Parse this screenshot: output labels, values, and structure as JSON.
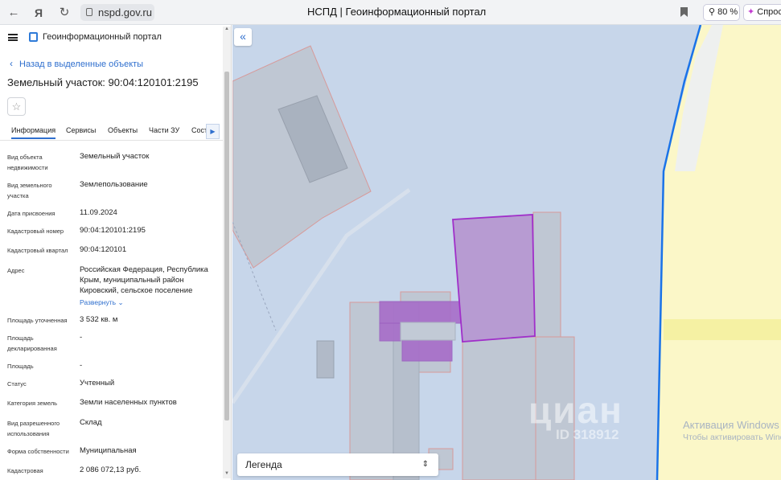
{
  "browser": {
    "url": "nspd.gov.ru",
    "tab_title": "НСПД | Геоинформационный портал",
    "zoom": "80 %",
    "ask_label": "Спроси"
  },
  "panel": {
    "brand": "Геоинформационный портал",
    "back_label": "Назад в выделенные объекты",
    "title": "Земельный участок: 90:04:120101:2195",
    "tabs": [
      "Информация",
      "Сервисы",
      "Объекты",
      "Части ЗУ",
      "Сост"
    ],
    "rows": [
      {
        "label": "Вид объекта недвижимости",
        "value": "Земельный участок"
      },
      {
        "label": "Вид земельного участка",
        "value": "Землепользование"
      },
      {
        "label": "Дата присвоения",
        "value": "11.09.2024"
      },
      {
        "label": "Кадастровый номер",
        "value": "90:04:120101:2195"
      },
      {
        "label": "Кадастровый квартал",
        "value": "90:04:120101"
      },
      {
        "label": "Адрес",
        "value": "Российская Федерация, Республика Крым, муниципальный район Кировский, сельское поселение"
      },
      {
        "label": "Площадь уточненная",
        "value": "3 532 кв. м"
      },
      {
        "label": "Площадь декларированная",
        "value": "-"
      },
      {
        "label": "Площадь",
        "value": "-"
      },
      {
        "label": "Статус",
        "value": "Учтенный"
      },
      {
        "label": "Категория земель",
        "value": "Земли населенных пунктов"
      },
      {
        "label": "Вид разрешенного использования",
        "value": "Склад"
      },
      {
        "label": "Форма собственности",
        "value": "Муниципальная"
      },
      {
        "label": "Кадастровая",
        "value": "2 086 072,13 руб."
      }
    ],
    "expand_label": "Развернуть"
  },
  "map": {
    "legend_label": "Легенда",
    "watermark_title": "Активация Windows",
    "watermark_text": "Чтобы активировать Windows, перейдите в раздел \"Параметры\".",
    "cian_text": "циан",
    "cian_id": "ID 318912"
  },
  "colors": {
    "map_bg": "#c7d6ea",
    "parcel_fill": "#bfc7d3",
    "selected": "#a02fc9",
    "settlement": "#fbf7c8",
    "boundary": "#1a73e8",
    "link": "#2f6fce"
  }
}
